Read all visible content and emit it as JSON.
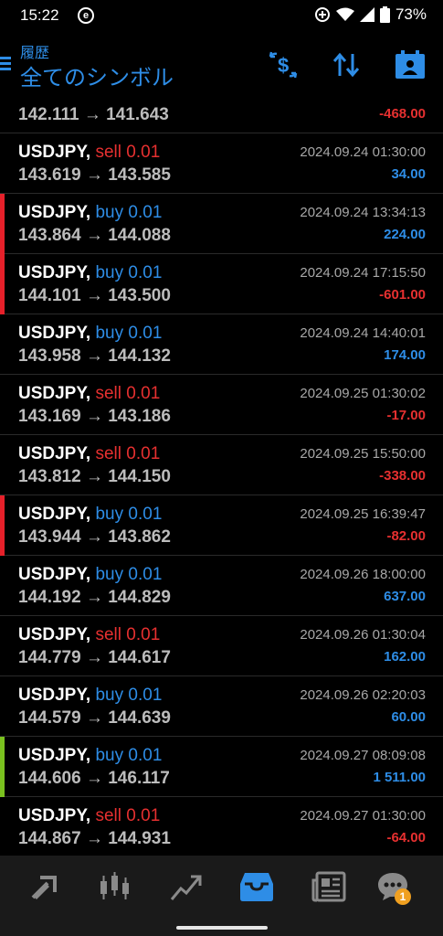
{
  "status_bar": {
    "time": "15:22",
    "app_icon": "e",
    "battery": "73%"
  },
  "header": {
    "subtitle": "履歴",
    "title": "全てのシンボル"
  },
  "colors": {
    "accent": "#2e8de6",
    "sell": "#e63030",
    "buy": "#2e8de6",
    "loss": "#e63030",
    "profit": "#2e8de6",
    "bar_red": "#e6202a",
    "bar_green": "#7ac11f"
  },
  "trades": [
    {
      "symbol": "",
      "dir": "",
      "lot": "",
      "prices": "142.111 → 141.643",
      "time": "",
      "pl": "-468.00",
      "pl_type": "loss",
      "bar": "none"
    },
    {
      "symbol": "USDJPY,",
      "dir": "sell",
      "lot": "0.01",
      "prices": "143.619 → 143.585",
      "time": "2024.09.24 01:30:00",
      "pl": "34.00",
      "pl_type": "profit",
      "bar": "none"
    },
    {
      "symbol": "USDJPY,",
      "dir": "buy",
      "lot": "0.01",
      "prices": "143.864 → 144.088",
      "time": "2024.09.24 13:34:13",
      "pl": "224.00",
      "pl_type": "profit",
      "bar": "red"
    },
    {
      "symbol": "USDJPY,",
      "dir": "buy",
      "lot": "0.01",
      "prices": "144.101 → 143.500",
      "time": "2024.09.24 17:15:50",
      "pl": "-601.00",
      "pl_type": "loss",
      "bar": "red"
    },
    {
      "symbol": "USDJPY,",
      "dir": "buy",
      "lot": "0.01",
      "prices": "143.958 → 144.132",
      "time": "2024.09.24 14:40:01",
      "pl": "174.00",
      "pl_type": "profit",
      "bar": "none"
    },
    {
      "symbol": "USDJPY,",
      "dir": "sell",
      "lot": "0.01",
      "prices": "143.169 → 143.186",
      "time": "2024.09.25 01:30:02",
      "pl": "-17.00",
      "pl_type": "loss",
      "bar": "none"
    },
    {
      "symbol": "USDJPY,",
      "dir": "sell",
      "lot": "0.01",
      "prices": "143.812 → 144.150",
      "time": "2024.09.25 15:50:00",
      "pl": "-338.00",
      "pl_type": "loss",
      "bar": "none"
    },
    {
      "symbol": "USDJPY,",
      "dir": "buy",
      "lot": "0.01",
      "prices": "143.944 → 143.862",
      "time": "2024.09.25 16:39:47",
      "pl": "-82.00",
      "pl_type": "loss",
      "bar": "red"
    },
    {
      "symbol": "USDJPY,",
      "dir": "buy",
      "lot": "0.01",
      "prices": "144.192 → 144.829",
      "time": "2024.09.26 18:00:00",
      "pl": "637.00",
      "pl_type": "profit",
      "bar": "none"
    },
    {
      "symbol": "USDJPY,",
      "dir": "sell",
      "lot": "0.01",
      "prices": "144.779 → 144.617",
      "time": "2024.09.26 01:30:04",
      "pl": "162.00",
      "pl_type": "profit",
      "bar": "none"
    },
    {
      "symbol": "USDJPY,",
      "dir": "buy",
      "lot": "0.01",
      "prices": "144.579 → 144.639",
      "time": "2024.09.26 02:20:03",
      "pl": "60.00",
      "pl_type": "profit",
      "bar": "none"
    },
    {
      "symbol": "USDJPY,",
      "dir": "buy",
      "lot": "0.01",
      "prices": "144.606 → 146.117",
      "time": "2024.09.27 08:09:08",
      "pl": "1 511.00",
      "pl_type": "profit",
      "bar": "green"
    },
    {
      "symbol": "USDJPY,",
      "dir": "sell",
      "lot": "0.01",
      "prices": "144.867 → 144.931",
      "time": "2024.09.27 01:30:00",
      "pl": "-64.00",
      "pl_type": "loss",
      "bar": "none"
    }
  ],
  "bottom_nav": {
    "items": [
      "quotes-icon",
      "chart-icon",
      "trade-icon",
      "history-icon",
      "news-icon",
      "chat-icon"
    ],
    "active": "history-icon",
    "chat_badge": "1"
  }
}
